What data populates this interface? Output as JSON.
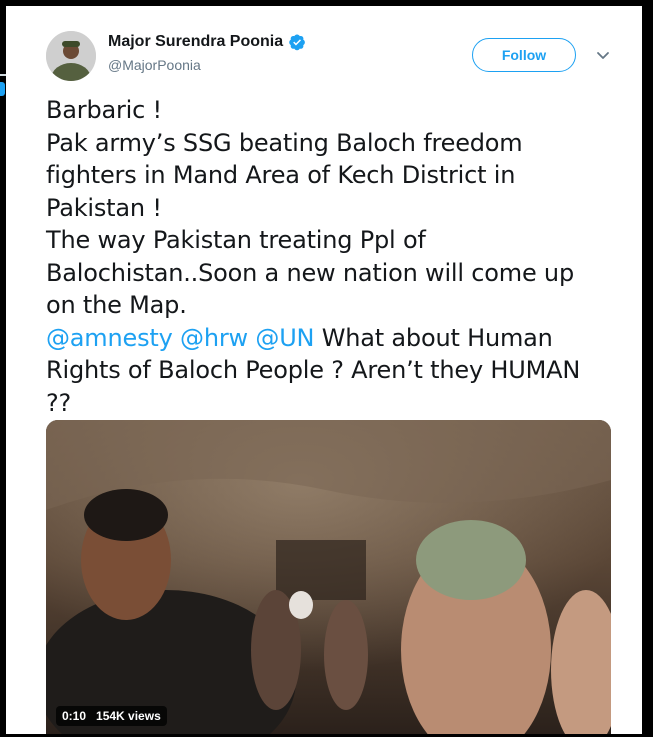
{
  "author": {
    "name": "Major Surendra Poonia",
    "handle": "@MajorPoonia",
    "verified": true
  },
  "actions": {
    "follow_label": "Follow"
  },
  "tweet": {
    "lines": [
      [
        {
          "text": "Barbaric !",
          "mention": false
        }
      ],
      [
        {
          "text": "Pak army’s SSG beating Baloch freedom",
          "mention": false
        }
      ],
      [
        {
          "text": "fighters in Mand Area of Kech District in",
          "mention": false
        }
      ],
      [
        {
          "text": "Pakistan !",
          "mention": false
        }
      ],
      [
        {
          "text": "The way Pakistan treating Ppl of",
          "mention": false
        }
      ],
      [
        {
          "text": "Balochistan..Soon a new nation will come up",
          "mention": false
        }
      ],
      [
        {
          "text": "on the Map.",
          "mention": false
        }
      ],
      [
        {
          "text": "@amnesty",
          "mention": true
        },
        {
          "text": " ",
          "mention": false
        },
        {
          "text": "@hrw",
          "mention": true
        },
        {
          "text": " ",
          "mention": false
        },
        {
          "text": "@UN",
          "mention": true
        },
        {
          "text": " What about Human",
          "mention": false
        }
      ],
      [
        {
          "text": "Rights of Baloch People ? Aren’t they HUMAN",
          "mention": false
        }
      ],
      [
        {
          "text": "??",
          "mention": false
        }
      ]
    ]
  },
  "video": {
    "duration": "0:10",
    "views": "154K views"
  },
  "colors": {
    "accent": "#1da1f2",
    "text": "#14171a",
    "secondary": "#657786"
  },
  "icons": {
    "verified": "verified-badge-icon",
    "menu": "chevron-down-icon"
  }
}
